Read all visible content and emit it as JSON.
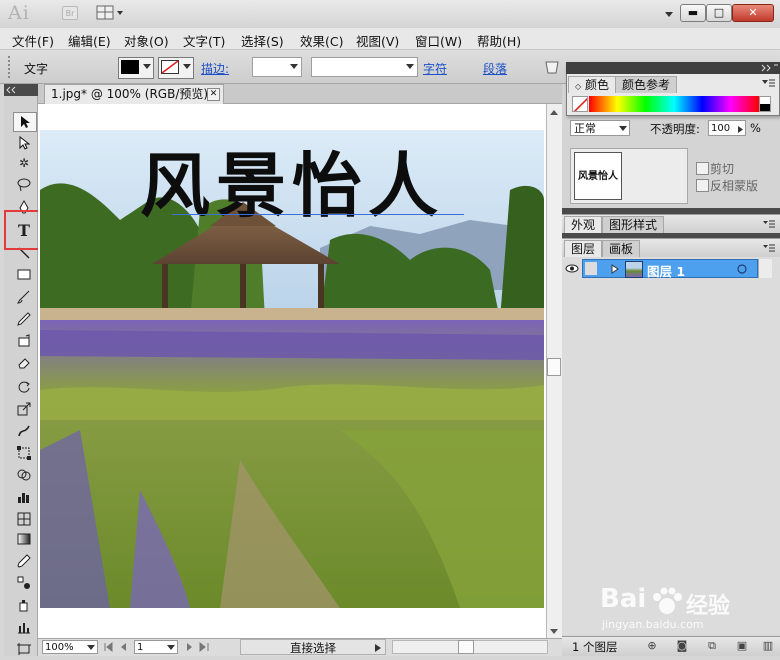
{
  "app": {
    "logo": "Ai",
    "bridge_badge": "Br",
    "window_controls": {
      "minimize": "▬",
      "maximize": "□",
      "close": "✕"
    }
  },
  "menu": {
    "items": [
      "文件(F)",
      "编辑(E)",
      "对象(O)",
      "文字(T)",
      "选择(S)",
      "效果(C)",
      "视图(V)",
      "窗口(W)",
      "帮助(H)"
    ]
  },
  "control_bar": {
    "tool_name": "文字",
    "stroke_label": "描边:",
    "char_link": "字符",
    "para_link": "段落"
  },
  "document": {
    "tab_title": "1.jpg* @ 100% (RGB/预览)",
    "tab_close": "✕",
    "headline_text": "风景怡人"
  },
  "status": {
    "zoom": "100%",
    "page": "1",
    "tool_status": "直接选择"
  },
  "panels": {
    "color_tab": "颜色",
    "color_guide_tab": "颜色参考",
    "blend_mode": "正常",
    "opacity_label": "不透明度:",
    "opacity_value": "100",
    "opacity_unit": "%",
    "thumb_text": "风景怡人",
    "clip_label": "剪切",
    "invert_mask_label": "反相蒙版",
    "appearance_tab": "外观",
    "graphic_styles_tab": "图形样式",
    "layers_tab": "图层",
    "artboards_tab": "画板",
    "layer_name": "图层 1",
    "layer_count": "1 个图层"
  },
  "watermark": {
    "brand": "Bai",
    "brand_cn": "经验",
    "url": "jingyan.baidu.com"
  },
  "colors": {
    "accent_blue": "#4da0ee",
    "highlight_red": "#e23b3b",
    "link_blue": "#1a50c7"
  }
}
